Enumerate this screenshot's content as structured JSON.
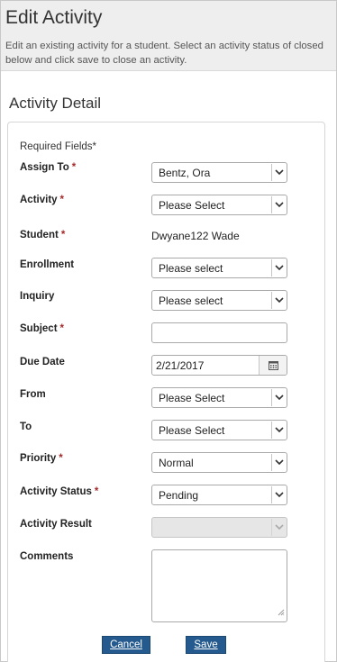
{
  "header": {
    "title": "Edit Activity",
    "description_line1": "Edit an existing activity for a student. Select an activity status of closed",
    "description_line2": "below and click save to close an activity."
  },
  "section": {
    "title": "Activity Detail"
  },
  "form": {
    "required_note": "Required Fields*",
    "required_marker": "*",
    "assign_to": {
      "label": "Assign To",
      "value": "Bentz, Ora"
    },
    "activity": {
      "label": "Activity",
      "value": "Please Select"
    },
    "student": {
      "label": "Student",
      "value": "Dwyane122 Wade"
    },
    "enrollment": {
      "label": "Enrollment",
      "value": "Please select"
    },
    "inquiry": {
      "label": "Inquiry",
      "value": "Please select"
    },
    "subject": {
      "label": "Subject",
      "value": ""
    },
    "due_date": {
      "label": "Due Date",
      "value": "2/21/2017"
    },
    "from": {
      "label": "From",
      "value": "Please Select"
    },
    "to": {
      "label": "To",
      "value": "Please Select"
    },
    "priority": {
      "label": "Priority",
      "value": "Normal"
    },
    "activity_status": {
      "label": "Activity Status",
      "value": "Pending"
    },
    "activity_result": {
      "label": "Activity Result",
      "value": ""
    },
    "comments": {
      "label": "Comments",
      "value": ""
    }
  },
  "buttons": {
    "cancel": "Cancel",
    "save": "Save"
  },
  "colors": {
    "button_bg": "#255a8e",
    "required_star": "#a52a2a",
    "header_bg": "#eeeeee"
  }
}
